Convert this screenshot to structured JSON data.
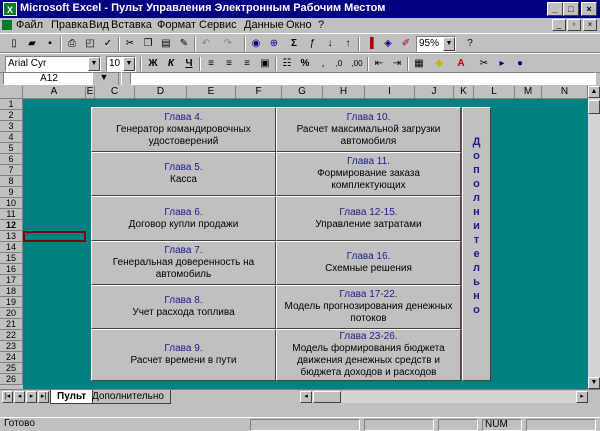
{
  "window": {
    "title": "Microsoft Excel - Пульт Управления Электронным Рабочим Местом",
    "app_icon": "X"
  },
  "menu": [
    "Файл",
    "Правка",
    "Вид",
    "Вставка",
    "Формат",
    "Сервис",
    "Данные",
    "Окно",
    "?"
  ],
  "toolbar": {
    "zoom": "95%",
    "font": "Arial Cyr",
    "size": "10"
  },
  "formula": {
    "cell_ref": "A12",
    "content": ""
  },
  "columns": [
    "A",
    "E",
    "C",
    "D",
    "E",
    "F",
    "G",
    "H",
    "I",
    "J",
    "K",
    "L",
    "M",
    "N"
  ],
  "rows": [
    "1",
    "2",
    "3",
    "4",
    "5",
    "6",
    "7",
    "8",
    "9",
    "10",
    "11",
    "12",
    "13",
    "14",
    "15",
    "16",
    "17",
    "18",
    "19",
    "20",
    "21",
    "22",
    "23",
    "24",
    "25",
    "26"
  ],
  "panels_left": [
    {
      "chapter": "Глава 4.",
      "text": "Генератор командировочных удостоверений"
    },
    {
      "chapter": "Глава 5.",
      "text": "Касса"
    },
    {
      "chapter": "Глава 6.",
      "text": "Договор купли продажи"
    },
    {
      "chapter": "Глава 7.",
      "text": "Генеральная доверенность на автомобиль"
    },
    {
      "chapter": "Глава 8.",
      "text": "Учет расхода топлива"
    },
    {
      "chapter": "Глава 9.",
      "text": "Расчет времени в пути"
    }
  ],
  "panels_right": [
    {
      "chapter": "Глава 10.",
      "text": "Расчет максимальной загрузки автомобиля"
    },
    {
      "chapter": "Глава 11.",
      "text": "Формирование заказа комплектующих"
    },
    {
      "chapter": "Глава 12-15.",
      "text": "Управление затратами"
    },
    {
      "chapter": "Глава 16.",
      "text": "Схемные решения"
    },
    {
      "chapter": "Глава 17-22.",
      "text": "Модель прогнозирования денежных потоков"
    },
    {
      "chapter": "Глава 23-26.",
      "text": "Модель формирования бюджета движения денежных средств и бюджета доходов и расходов"
    }
  ],
  "vertical_button": [
    "Д",
    "о",
    "п",
    "о",
    "л",
    "н",
    "и",
    "т",
    "е",
    "л",
    "ь",
    "н",
    "о"
  ],
  "sheet_tabs": [
    "Пульт",
    "Дополнительно"
  ],
  "status": {
    "ready": "Готово",
    "num": "NUM"
  },
  "colors": {
    "grid_bg": "#008080",
    "chapter_text": "#1c1c8c",
    "title_bg": "#000080"
  }
}
